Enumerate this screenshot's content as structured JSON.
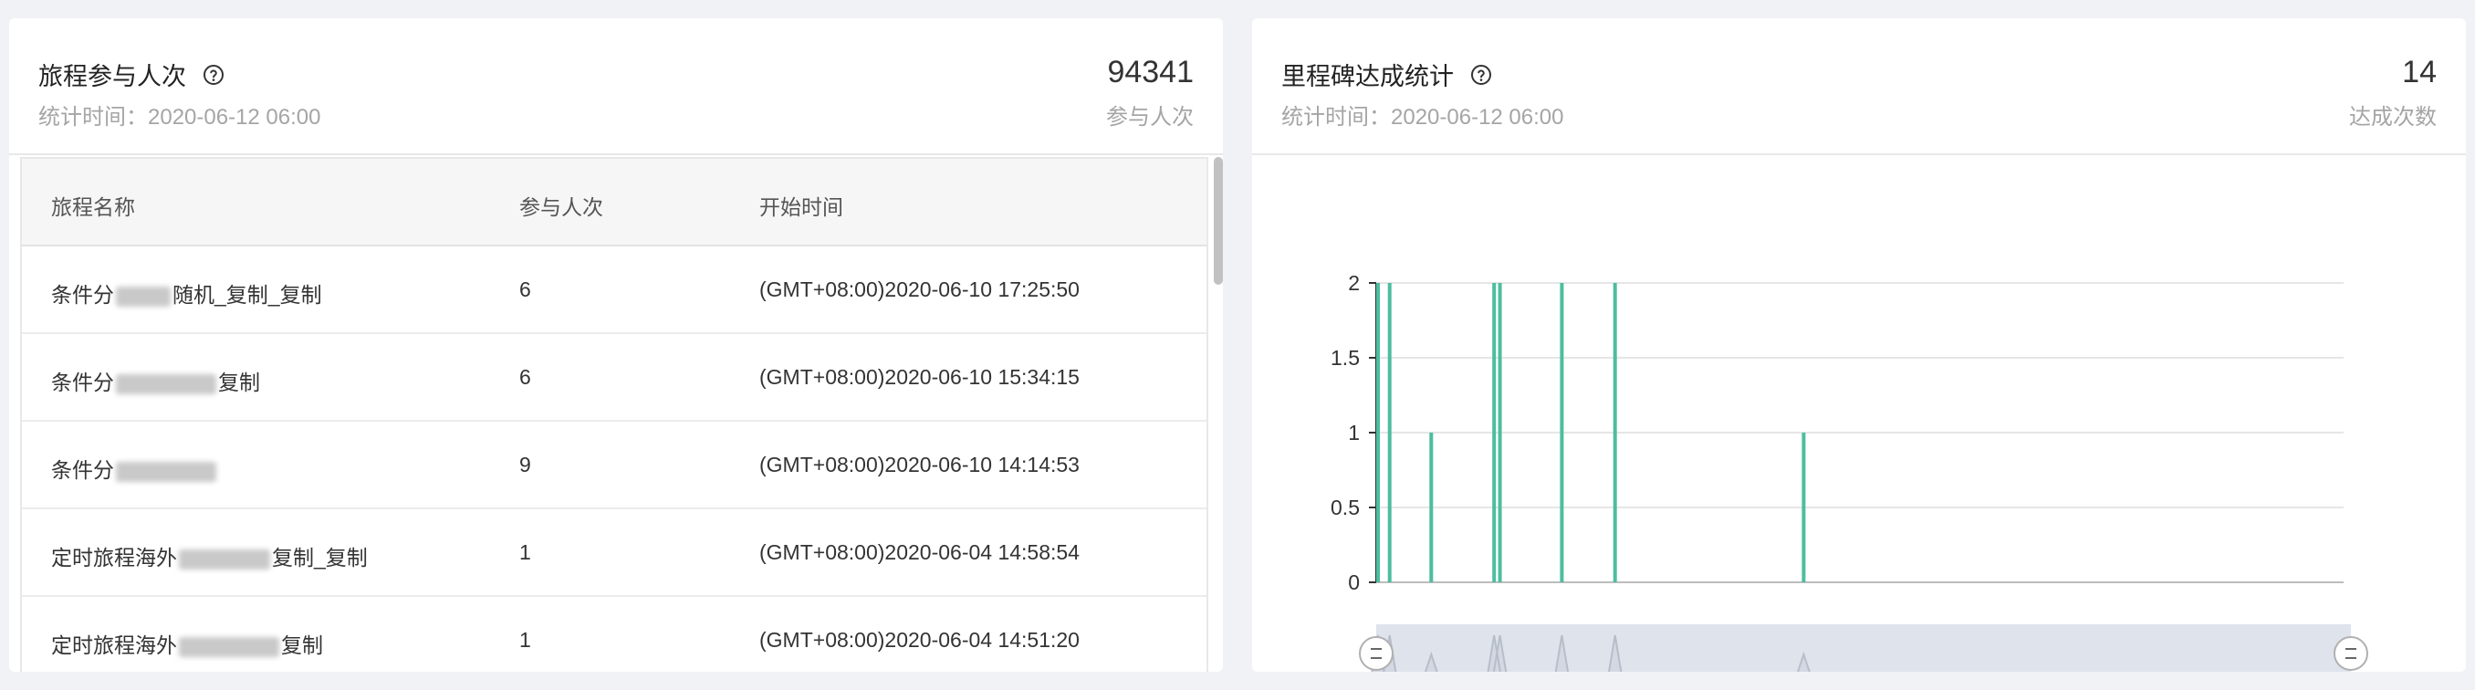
{
  "left_card": {
    "title": "旅程参与人次",
    "subtitle": "统计时间：2020-06-12 06:00",
    "metric_value": "94341",
    "metric_label": "参与人次",
    "table": {
      "headers": [
        "旅程名称",
        "参与人次",
        "开始时间"
      ],
      "rows": [
        {
          "name_start": "条件分",
          "name_end": "随机_复制_复制",
          "count": "6",
          "time": "(GMT+08:00)2020-06-10 17:25:50"
        },
        {
          "name_start": "条件分",
          "name_end": "复制",
          "count": "6",
          "time": "(GMT+08:00)2020-06-10 15:34:15"
        },
        {
          "name_start": "条件分",
          "name_end": "",
          "count": "9",
          "time": "(GMT+08:00)2020-06-10 14:14:53"
        },
        {
          "name_start": "定时旅程海外",
          "name_end": "复制_复制",
          "count": "1",
          "time": "(GMT+08:00)2020-06-04 14:58:54"
        },
        {
          "name_start": "定时旅程海外",
          "name_end": "复制",
          "count": "1",
          "time": "(GMT+08:00)2020-06-04 14:51:20"
        }
      ]
    }
  },
  "right_card": {
    "title": "里程碑达成统计",
    "subtitle": "统计时间：2020-06-12 06:00",
    "metric_value": "14",
    "metric_label": "达成次数"
  },
  "chart_data": {
    "type": "bar",
    "ylim": [
      0,
      2
    ],
    "yticks": [
      "0",
      "0.5",
      "1",
      "1.5",
      "2"
    ],
    "grid": true,
    "color": "#4dbd9f",
    "x_domain": [
      0,
      100
    ],
    "x": [
      0,
      1.2,
      5.5,
      12,
      12.6,
      19,
      24.5,
      44
    ],
    "values": [
      2,
      2,
      1,
      2,
      2,
      2,
      2,
      1
    ]
  },
  "colors": {
    "bar": "#4dbd9f",
    "grid": "#e6e6e6",
    "slider_bg": "#dfe3ec"
  }
}
